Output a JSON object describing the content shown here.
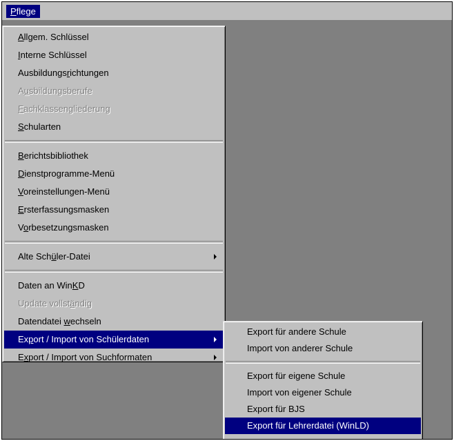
{
  "menubar": {
    "title": "Pflege"
  },
  "main_menu": {
    "group1": [
      {
        "pre": "",
        "u": "A",
        "post": "llgem. Schlüssel",
        "disabled": false
      },
      {
        "pre": "",
        "u": "I",
        "post": "nterne Schlüssel",
        "disabled": false
      },
      {
        "pre": "Ausbildungs",
        "u": "r",
        "post": "ichtungen",
        "disabled": false
      },
      {
        "pre": "A",
        "u": "u",
        "post": "sbildungsberufe",
        "disabled": true
      },
      {
        "pre": "",
        "u": "F",
        "post": "achklassengliederung",
        "disabled": true
      },
      {
        "pre": "",
        "u": "S",
        "post": "chularten",
        "disabled": false
      }
    ],
    "group2": [
      {
        "pre": "",
        "u": "B",
        "post": "erichtsbibliothek",
        "disabled": false
      },
      {
        "pre": "",
        "u": "D",
        "post": "ienstprogramme-Menü",
        "disabled": false
      },
      {
        "pre": "",
        "u": "V",
        "post": "oreinstellungen-Menü",
        "disabled": false
      },
      {
        "pre": "",
        "u": "E",
        "post": "rsterfassungsmasken",
        "disabled": false
      },
      {
        "pre": "V",
        "u": "o",
        "post": "rbesetzungsmasken",
        "disabled": false
      }
    ],
    "group3": [
      {
        "pre": "Alte Sch",
        "u": "ü",
        "post": "ler-Datei",
        "disabled": false
      }
    ],
    "group4": [
      {
        "pre": "Daten an Win",
        "u": "K",
        "post": "D",
        "disabled": false
      },
      {
        "pre": "Update vollst",
        "u": "ä",
        "post": "ndig",
        "disabled": true
      },
      {
        "pre": "Datendatei ",
        "u": "w",
        "post": "echseln",
        "disabled": false
      },
      {
        "pre": "Ex",
        "u": "p",
        "post": "ort / Import von Schülerdaten",
        "disabled": false
      },
      {
        "pre": "E",
        "u": "x",
        "post": "port / Import von Suchformaten",
        "disabled": false
      }
    ]
  },
  "sub_menu": {
    "group1": [
      {
        "label": "Export für andere Schule"
      },
      {
        "label": "Import von anderer Schule"
      }
    ],
    "group2": [
      {
        "label": "Export für eigene Schule"
      },
      {
        "label": "Import von eigener Schule"
      },
      {
        "label": "Export für BJS"
      },
      {
        "label": "Export für Lehrerdatei (WinLD)"
      }
    ]
  },
  "colors": {
    "highlight": "#000080",
    "menu_face": "#c0c0c0",
    "desktop": "#808080"
  }
}
